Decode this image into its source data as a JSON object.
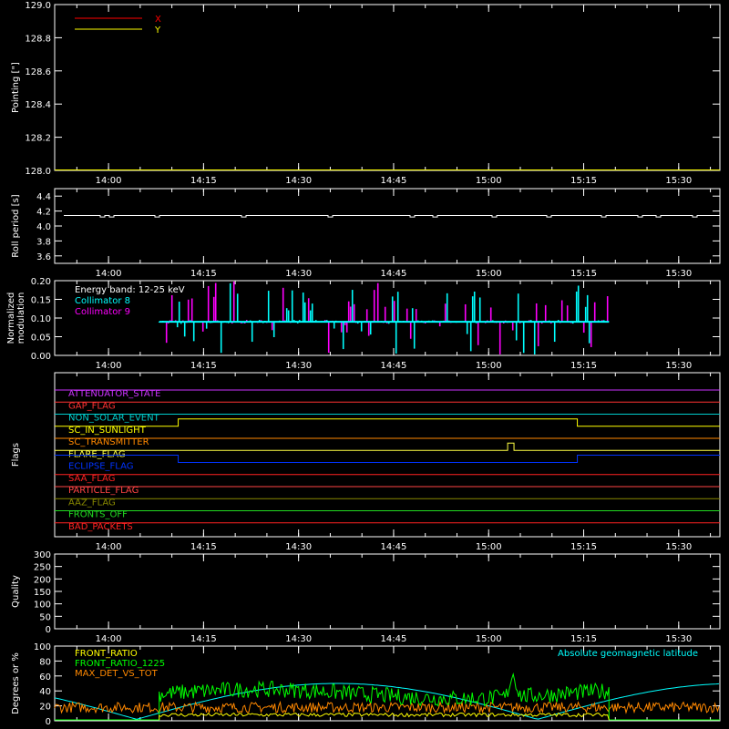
{
  "time_ticks": [
    "14:00",
    "14:15",
    "14:30",
    "14:45",
    "15:00",
    "15:15",
    "15:30"
  ],
  "chart_data": [
    {
      "type": "line",
      "ylabel": "Pointing [\"]",
      "ylim": [
        128.0,
        129.0
      ],
      "yticks": [
        "129.0",
        "128.8",
        "128.6",
        "128.4",
        "128.2",
        "128.0"
      ],
      "legend": [
        {
          "name": "X",
          "color": "#ff0000"
        },
        {
          "name": "Y",
          "color": "#ffff00"
        }
      ],
      "series": [
        {
          "name": "X",
          "color": "#ff0000",
          "values": [
            128.0,
            128.0
          ]
        },
        {
          "name": "Y",
          "color": "#ffff00",
          "values": [
            128.0,
            128.0
          ]
        }
      ]
    },
    {
      "type": "line",
      "ylabel": "Roll period [s]",
      "ylim": [
        3.5,
        4.5
      ],
      "yticks": [
        "4.4",
        "4.2",
        "4.0",
        "3.8",
        "3.6"
      ],
      "series": [
        {
          "name": "roll",
          "color": "#ffffff",
          "value": 4.14,
          "dip": 4.12
        }
      ]
    },
    {
      "type": "bar",
      "ylabel_lines": [
        "Normalized",
        "modulation"
      ],
      "ylim": [
        0.0,
        0.2
      ],
      "yticks": [
        "0.20",
        "0.15",
        "0.10",
        "0.05",
        "0.00"
      ],
      "legend_title": "Energy band: 12-25 keV",
      "legend": [
        {
          "name": "Collimator 8",
          "color": "#00ffff"
        },
        {
          "name": "Collimator 9",
          "color": "#ff00ff"
        }
      ],
      "active_range": [
        "14:08",
        "15:19"
      ],
      "baseline": 0.09,
      "series": [
        {
          "name": "Collimator 8",
          "color": "#00ffff"
        },
        {
          "name": "Collimator 9",
          "color": "#ff00ff"
        }
      ]
    },
    {
      "type": "line",
      "ylabel": "Flags",
      "flags": [
        {
          "name": "ATTENUATOR_STATE",
          "color": "#cc33ff",
          "level": 0
        },
        {
          "name": "GAP_FLAG",
          "color": "#ff3333",
          "level": 0
        },
        {
          "name": "NON_SOLAR_EVENT",
          "color": "#00cccc",
          "level": 0
        },
        {
          "name": "SC_IN_SUNLIGHT",
          "color": "#ffff00",
          "level": 0,
          "on_ranges": [
            [
              "14:11",
              "15:14"
            ]
          ]
        },
        {
          "name": "SC_TRANSMITTER",
          "color": "#ff8800",
          "level": 0
        },
        {
          "name": "FLARE_FLAG",
          "color": "#ffff44",
          "level": 0,
          "on_ranges": [
            [
              "15:03",
              "15:04"
            ]
          ]
        },
        {
          "name": "ECLIPSE_FLAG",
          "color": "#0033ff",
          "level": 1,
          "off_ranges": [
            [
              "14:11",
              "15:14"
            ]
          ]
        },
        {
          "name": "SAA_FLAG",
          "color": "#ff2222",
          "level": 0
        },
        {
          "name": "PARTICLE_FLAG",
          "color": "#ff4444",
          "level": 0
        },
        {
          "name": "AAZ_FLAG",
          "color": "#888800",
          "level": 0
        },
        {
          "name": "FRONTS_OFF",
          "color": "#22dd22",
          "level": 0
        },
        {
          "name": "BAD_PACKETS",
          "color": "#ff2222",
          "level": 0
        }
      ]
    },
    {
      "type": "line",
      "ylabel": "Quality",
      "ylim": [
        0,
        300
      ],
      "yticks": [
        "300",
        "250",
        "200",
        "150",
        "100",
        "50",
        "0"
      ],
      "series": []
    },
    {
      "type": "line",
      "ylabel": "Degrees or %",
      "ylim": [
        0,
        100
      ],
      "yticks": [
        "100",
        "80",
        "60",
        "40",
        "20",
        "0"
      ],
      "legend": [
        {
          "name": "FRONT_RATIO",
          "color": "#ffff00"
        },
        {
          "name": "FRONT_RATIO_1225",
          "color": "#00ff00"
        },
        {
          "name": "MAX_DET_VS_TOT",
          "color": "#ff8800"
        }
      ],
      "legend_right": {
        "name": "Absolute geomagnetic latitude",
        "color": "#00ffff"
      },
      "active_range": [
        "14:08",
        "15:19"
      ],
      "series": [
        {
          "name": "FRONT_RATIO",
          "color": "#ffff00",
          "level": 8
        },
        {
          "name": "FRONT_RATIO_1225",
          "color": "#00ff00",
          "level": 40
        },
        {
          "name": "MAX_DET_VS_TOT",
          "color": "#ff8800",
          "level": 20
        },
        {
          "name": "Absolute geomagnetic latitude",
          "color": "#00ffff"
        }
      ]
    }
  ]
}
